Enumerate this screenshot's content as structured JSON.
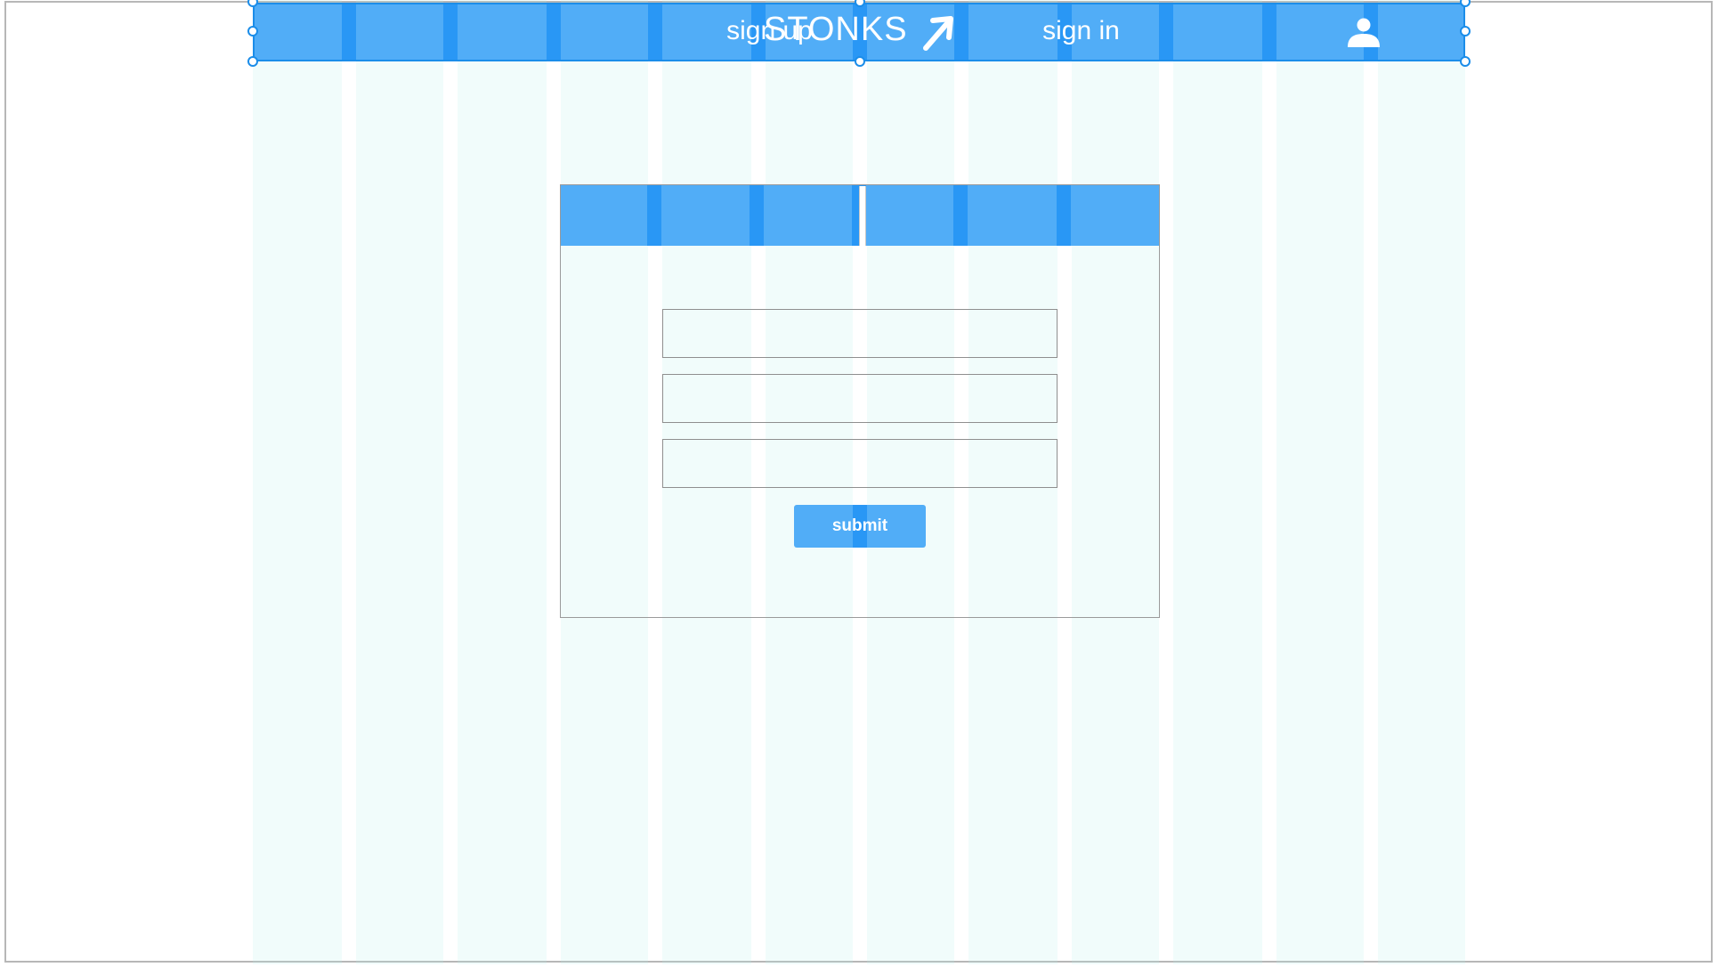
{
  "header": {
    "brand": "STONKS",
    "brand_icon": "arrow-up-right-icon",
    "user_icon": "user-icon"
  },
  "auth": {
    "tabs": [
      {
        "label": "sign up"
      },
      {
        "label": "sign in"
      }
    ],
    "fields": [
      {
        "value": "",
        "placeholder": ""
      },
      {
        "value": "",
        "placeholder": ""
      },
      {
        "value": "",
        "placeholder": ""
      }
    ],
    "submit_label": "submit"
  },
  "colors": {
    "primary": "#51adf7",
    "primary_dark": "#2997f5",
    "selection": "#1b8de9",
    "grid": "#afeceae0",
    "border": "#9a9a9a"
  }
}
